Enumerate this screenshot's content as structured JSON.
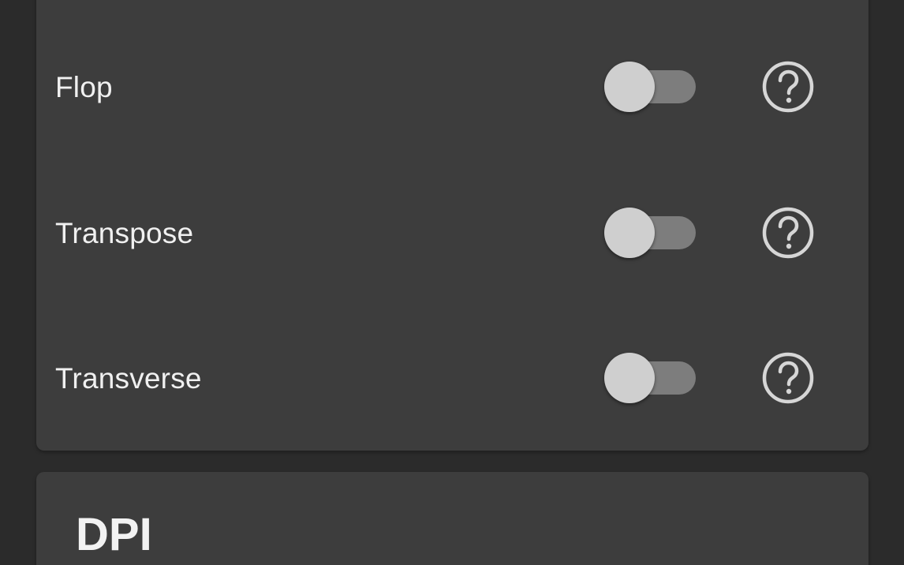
{
  "options": [
    {
      "label": "Flop",
      "enabled": false,
      "help_icon": "help-circle-icon"
    },
    {
      "label": "Transpose",
      "enabled": false,
      "help_icon": "help-circle-icon"
    },
    {
      "label": "Transverse",
      "enabled": false,
      "help_icon": "help-circle-icon"
    }
  ],
  "dpi_section": {
    "title": "DPI"
  },
  "colors": {
    "background": "#2b2b2b",
    "card": "#3d3d3d",
    "text": "#f0f0f0",
    "toggle_track_off": "#7d7d7d",
    "toggle_thumb_off": "#cfcfcf",
    "icon": "#d6d6d6"
  }
}
